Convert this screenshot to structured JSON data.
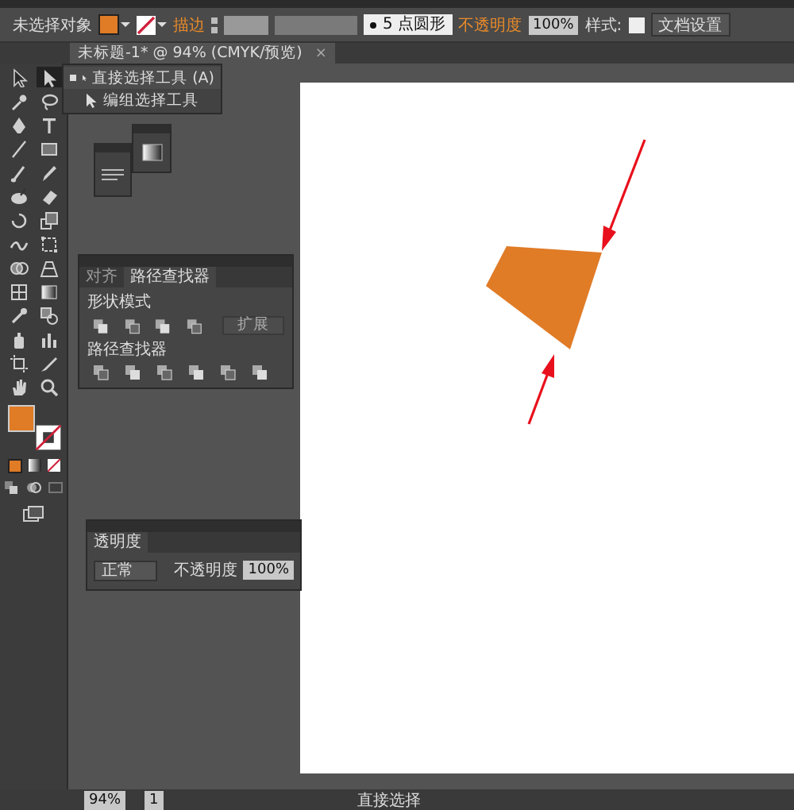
{
  "control_bar": {
    "selection_label": "未选择对象",
    "stroke_link": "描边",
    "brush": "5 点圆形",
    "opacity_link": "不透明度",
    "opacity": "100%",
    "style_label": "样式:",
    "doc_setup_button": "文档设置"
  },
  "document_tab": {
    "title": "未标题-1* @ 94% (CMYK/预览)",
    "close": "×"
  },
  "tools": [
    {
      "kind": "select",
      "selected": false
    },
    {
      "kind": "direct-select",
      "selected": true
    },
    {
      "kind": "magic-wand",
      "selected": false
    },
    {
      "kind": "lasso",
      "selected": false
    },
    {
      "kind": "pen",
      "selected": false
    },
    {
      "kind": "type",
      "selected": false
    },
    {
      "kind": "line",
      "selected": false
    },
    {
      "kind": "rect",
      "selected": false
    },
    {
      "kind": "brush",
      "selected": false
    },
    {
      "kind": "pencil",
      "selected": false
    },
    {
      "kind": "blob",
      "selected": false
    },
    {
      "kind": "eraser",
      "selected": false
    },
    {
      "kind": "rotate",
      "selected": false
    },
    {
      "kind": "scale",
      "selected": false
    },
    {
      "kind": "warp",
      "selected": false
    },
    {
      "kind": "free-transform",
      "selected": false
    },
    {
      "kind": "shape-builder",
      "selected": false
    },
    {
      "kind": "perspective",
      "selected": false
    },
    {
      "kind": "mesh",
      "selected": false
    },
    {
      "kind": "gradient",
      "selected": false
    },
    {
      "kind": "eyedropper",
      "selected": false
    },
    {
      "kind": "blend",
      "selected": false
    },
    {
      "kind": "symbol",
      "selected": false
    },
    {
      "kind": "graph",
      "selected": false
    },
    {
      "kind": "artboard",
      "selected": false
    },
    {
      "kind": "slice",
      "selected": false
    },
    {
      "kind": "hand",
      "selected": false
    },
    {
      "kind": "zoom",
      "selected": false
    }
  ],
  "tool_menu": {
    "items": [
      {
        "label": "直接选择工具 (A)",
        "selected": true
      },
      {
        "label": "编组选择工具",
        "selected": false
      }
    ]
  },
  "pathfinder_panel": {
    "tabs": [
      {
        "label": "对齐",
        "selected": false
      },
      {
        "label": "路径查找器",
        "selected": true
      }
    ],
    "shape_modes_label": "形状模式",
    "expand_button": "扩展",
    "pathfinders_label": "路径查找器"
  },
  "transparency_panel": {
    "tab": "透明度",
    "blend_mode": "正常",
    "opacity_label": "不透明度",
    "opacity": "100%"
  },
  "status_bar": {
    "zoom": "94%",
    "artboard": "1",
    "tool": "直接选择"
  }
}
